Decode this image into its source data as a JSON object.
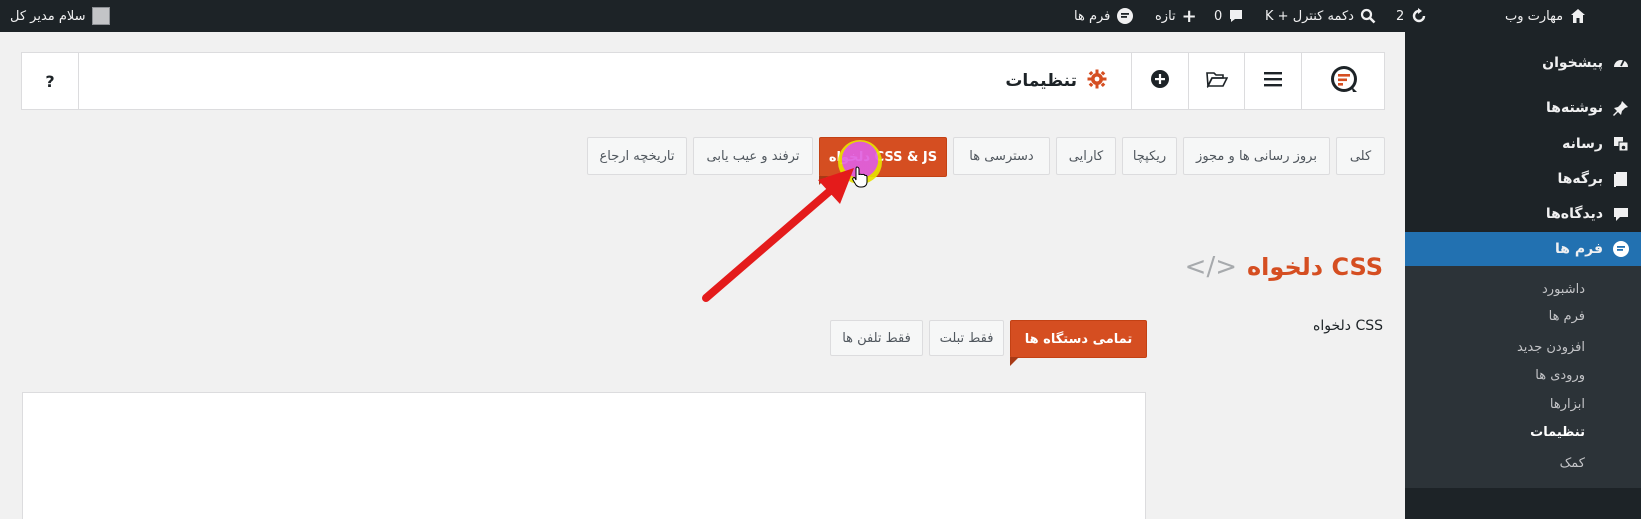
{
  "adminbar": {
    "site_name": "مهارت وب",
    "updates_count": "2",
    "search_shortcut": "دکمه کنترل + K",
    "comments_count": "0",
    "new_label": "تازه",
    "forms_label": "فرم ها",
    "greeting": "سلام مدیر کل"
  },
  "sidebar": {
    "items": [
      {
        "label": "پیشخوان",
        "icon": "dashboard-icon"
      },
      {
        "label": "نوشته‌ها",
        "icon": "pin-icon"
      },
      {
        "label": "رسانه",
        "icon": "media-icon"
      },
      {
        "label": "برگه‌ها",
        "icon": "pages-icon"
      },
      {
        "label": "دیدگاه‌ها",
        "icon": "comments-icon"
      },
      {
        "label": "فرم ها",
        "icon": "forms-icon"
      }
    ],
    "submenu": [
      {
        "label": "داشبورد"
      },
      {
        "label": "فرم ها"
      },
      {
        "label": "افزودن جدید"
      },
      {
        "label": "ورودی ها"
      },
      {
        "label": "ابزارها"
      },
      {
        "label": "تنظیمات"
      },
      {
        "label": "کمک"
      }
    ]
  },
  "toolbar": {
    "title": "تنظیمات",
    "help_label": "?"
  },
  "tabs": [
    {
      "label": "کلی"
    },
    {
      "label": "بروز رسانی ها و مجوز"
    },
    {
      "label": "ریکپچا"
    },
    {
      "label": "کارایی"
    },
    {
      "label": "دسترسی ها"
    },
    {
      "label": "CSS & JS دلخواه"
    },
    {
      "label": "ترفند و عیب یابی"
    },
    {
      "label": "تاریخچه ارجاع"
    }
  ],
  "section": {
    "title": "CSS دلخواه",
    "code_icon": "</>",
    "field_label": "CSS دلخواه"
  },
  "device_tabs": [
    {
      "label": "تمامی دستگاه ها"
    },
    {
      "label": "فقط تبلت"
    },
    {
      "label": "فقط تلفن ها"
    }
  ],
  "colors": {
    "accent": "#d54e21",
    "admin_dark": "#1d2327",
    "current_menu": "#2271b1"
  }
}
